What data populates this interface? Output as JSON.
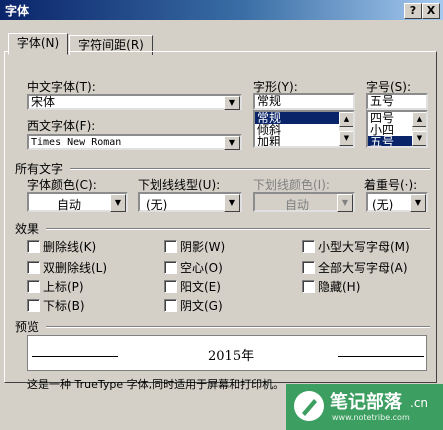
{
  "window": {
    "title": "字体",
    "help_btn": "?",
    "close_btn": "X"
  },
  "tabs": [
    {
      "label": "字体(N)"
    },
    {
      "label": "字符间距(R)"
    }
  ],
  "font": {
    "chinese_label": "中文字体(T):",
    "chinese_value": "宋体",
    "western_label": "西文字体(F):",
    "western_value": "Times New Roman",
    "style_label": "字形(Y):",
    "style_value": "常规",
    "style_options": [
      "常规",
      "倾斜",
      "加粗"
    ],
    "size_label": "字号(S):",
    "size_value": "五号",
    "size_options": [
      "四号",
      "小四",
      "五号"
    ]
  },
  "all_text": {
    "section_label": "所有文字",
    "color_label": "字体颜色(C):",
    "color_value": "自动",
    "underline_label": "下划线线型(U):",
    "underline_value": "(无)",
    "underline_color_label": "下划线颜色(I):",
    "underline_color_value": "自动",
    "emphasis_label": "着重号(·):",
    "emphasis_value": "(无)"
  },
  "effects": {
    "section_label": "效果",
    "items": [
      "删除线(K)",
      "双删除线(L)",
      "上标(P)",
      "下标(B)",
      "阴影(W)",
      "空心(O)",
      "阳文(E)",
      "阴文(G)",
      "小型大写字母(M)",
      "全部大写字母(A)",
      "隐藏(H)"
    ]
  },
  "preview": {
    "section_label": "预览",
    "sample": "2015年",
    "note": "这是一种 TrueType 字体,同时适用于屏幕和打印机。"
  },
  "watermark": {
    "text": "笔记部落",
    "url": "www.notetribe.com",
    "suffix": ".cn"
  },
  "colors": {
    "title_bar": "#0a246a",
    "selection": "#0a246a",
    "dialog": "#d4d0c8"
  }
}
